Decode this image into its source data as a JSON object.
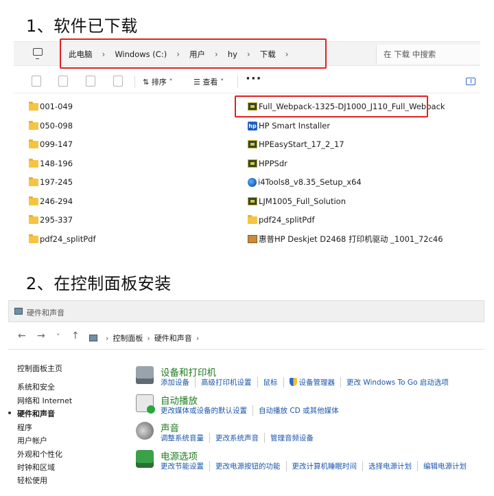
{
  "headings": {
    "step1": "1、软件已下载",
    "step2": "2、在控制面板安装"
  },
  "explorer": {
    "breadcrumb": [
      "此电脑",
      "Windows (C:)",
      "用户",
      "hy",
      "下载"
    ],
    "search_placeholder": "在 下载 中搜索",
    "toolbar": {
      "sort_label": "排序",
      "view_label": "查看",
      "more_label": "···"
    },
    "folders": [
      "001-049",
      "050-098",
      "099-147",
      "148-196",
      "197-245",
      "246-294",
      "295-337",
      "pdf24_splitPdf"
    ],
    "files": [
      {
        "name": "Full_Webpack-1325-DJ1000_J110_Full_Webpack",
        "icon": "installer-icon"
      },
      {
        "name": "HP Smart Installer",
        "icon": "hp-icon"
      },
      {
        "name": "HPEasyStart_17_2_17",
        "icon": "installer-icon"
      },
      {
        "name": "HPPSdr",
        "icon": "installer-icon"
      },
      {
        "name": "i4Tools8_v8.35_Setup_x64",
        "icon": "i4tools-icon"
      },
      {
        "name": "LJM1005_Full_Solution",
        "icon": "installer-icon"
      },
      {
        "name": "pdf24_splitPdf",
        "icon": "folder-icon"
      },
      {
        "name": "惠普HP Deskjet D2468 打印机驱动 _1001_72c46",
        "icon": "archive-icon"
      }
    ],
    "highlight_color": "#e02020"
  },
  "control_panel": {
    "window_title": "硬件和声音",
    "address": [
      "控制面板",
      "硬件和声音"
    ],
    "sidebar": [
      "控制面板主页",
      "系统和安全",
      "网络和 Internet",
      "硬件和声音",
      "程序",
      "用户帐户",
      "外观和个性化",
      "时钟和区域",
      "轻松使用"
    ],
    "active_sidebar": "硬件和声音",
    "categories": [
      {
        "title": "设备和打印机",
        "icon": "printer-icon",
        "links": [
          "添加设备",
          "高级打印机设置",
          "鼠标",
          "设备管理器",
          "更改 Windows To Go 启动选项"
        ]
      },
      {
        "title": "自动播放",
        "icon": "autoplay-icon",
        "links": [
          "更改媒体或设备的默认设置",
          "自动播放 CD 或其他媒体"
        ]
      },
      {
        "title": "声音",
        "icon": "speaker-icon",
        "links": [
          "调整系统音量",
          "更改系统声音",
          "管理音频设备"
        ]
      },
      {
        "title": "电源选项",
        "icon": "power-icon",
        "links": [
          "更改节能设置",
          "更改电源按钮的功能",
          "更改计算机睡眠时间",
          "选择电源计划",
          "编辑电源计划"
        ]
      }
    ],
    "title_color": "#1e7a1e",
    "link_color": "#1a55b0"
  }
}
